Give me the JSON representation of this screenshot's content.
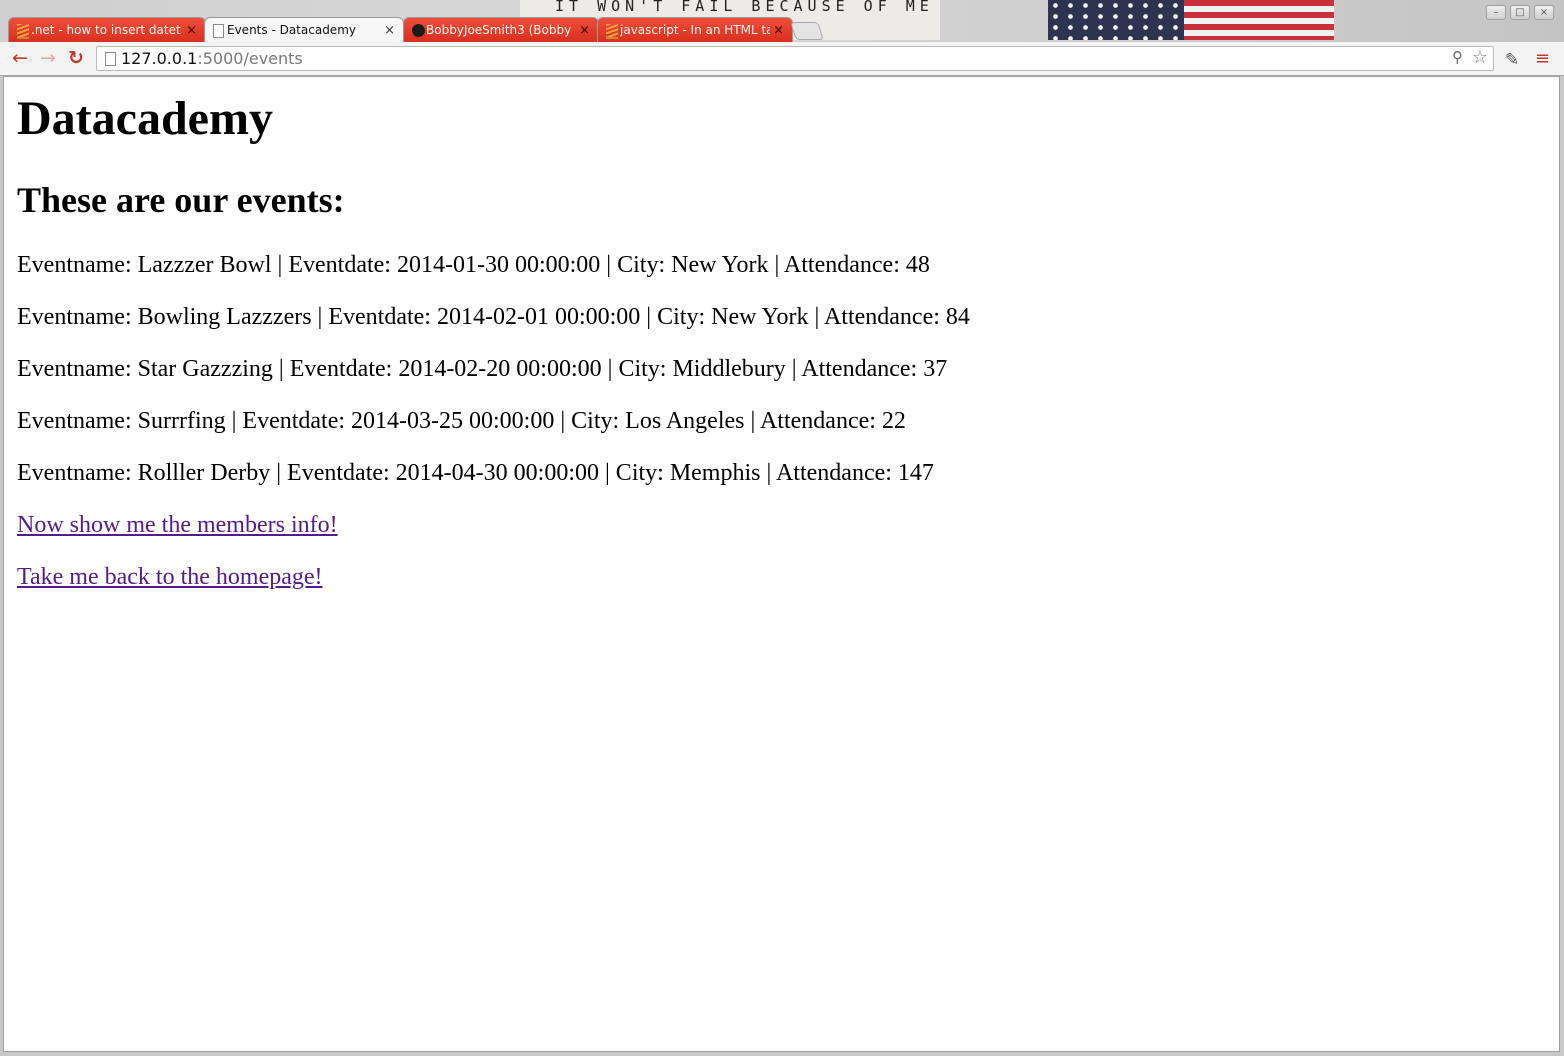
{
  "browser": {
    "tabs": [
      {
        "title": ".net - how to insert dateti",
        "icon": "stackoverflow-icon",
        "active": false
      },
      {
        "title": "Events - Datacademy",
        "icon": "page-icon",
        "active": true
      },
      {
        "title": "BobbyJoeSmith3 (Bobby",
        "icon": "github-icon",
        "active": false
      },
      {
        "title": "javascript - In an HTML tal",
        "icon": "stackoverflow-icon",
        "active": false
      }
    ],
    "tab_close_glyph": "×",
    "wallpaper_text": "IT WON'T FAIL BECAUSE OF ME",
    "window_controls": {
      "minimize": "–",
      "maximize": "□",
      "close": "×"
    },
    "toolbar": {
      "back": "←",
      "forward": "→",
      "reload": "↻",
      "url_host": "127.0.0.1",
      "url_path": ":5000/events",
      "zoom_glyph": "⚲",
      "star_glyph": "☆",
      "extension_glyph": "✎",
      "menu_glyph": "≡"
    },
    "accent_color": "#d9301f"
  },
  "page": {
    "title": "Datacademy",
    "subtitle": "These are our events:",
    "events": [
      {
        "text": "Eventname: Lazzzer Bowl | Eventdate: 2014-01-30 00:00:00 | City: New York | Attendance: 48"
      },
      {
        "text": "Eventname: Bowling Lazzzers | Eventdate: 2014-02-01 00:00:00 | City: New York | Attendance: 84"
      },
      {
        "text": "Eventname: Star Gazzzing | Eventdate: 2014-02-20 00:00:00 | City: Middlebury | Attendance: 37"
      },
      {
        "text": "Eventname: Surrrfing | Eventdate: 2014-03-25 00:00:00 | City: Los Angeles | Attendance: 22"
      },
      {
        "text": "Eventname: Rolller Derby | Eventdate: 2014-04-30 00:00:00 | City: Memphis | Attendance: 147"
      }
    ],
    "links": {
      "members": "Now show me the members info!",
      "home": "Take me back to the homepage!"
    },
    "link_color": "#551a8b"
  }
}
